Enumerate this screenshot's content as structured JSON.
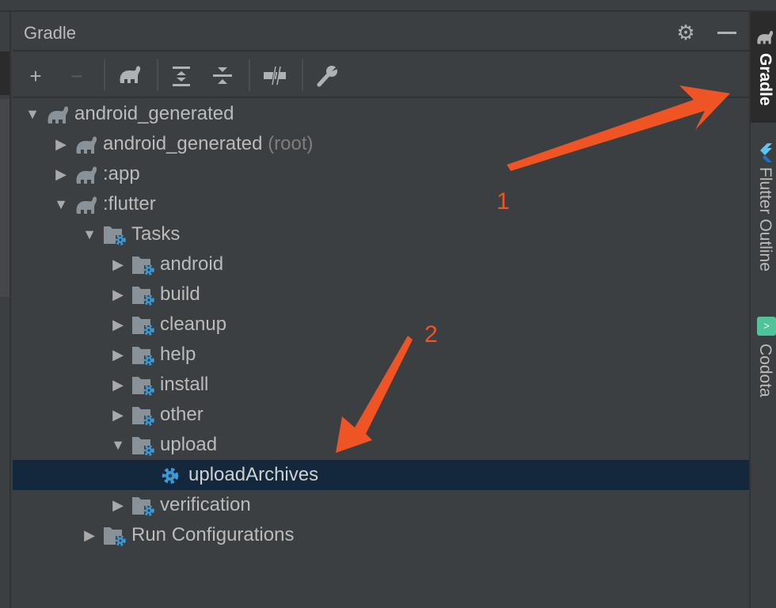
{
  "panel": {
    "title": "Gradle",
    "settings_icon": "gear-icon",
    "hide_icon": "minimize-icon"
  },
  "toolbar": {
    "items": [
      "add",
      "remove",
      "refresh-gradle",
      "expand-all",
      "collapse-all",
      "toggle-offline",
      "build-settings"
    ]
  },
  "tree": [
    {
      "label": "android_generated",
      "suffix": "",
      "level": 0,
      "expanded": true,
      "icon": "gradle-elephant-icon"
    },
    {
      "label": "android_generated",
      "suffix": "(root)",
      "level": 1,
      "expanded": false,
      "icon": "gradle-elephant-icon"
    },
    {
      "label": ":app",
      "suffix": "",
      "level": 1,
      "expanded": false,
      "icon": "gradle-elephant-icon"
    },
    {
      "label": ":flutter",
      "suffix": "",
      "level": 1,
      "expanded": true,
      "icon": "gradle-elephant-icon"
    },
    {
      "label": "Tasks",
      "suffix": "",
      "level": 2,
      "expanded": true,
      "icon": "task-folder-icon"
    },
    {
      "label": "android",
      "suffix": "",
      "level": 3,
      "expanded": false,
      "icon": "task-folder-icon"
    },
    {
      "label": "build",
      "suffix": "",
      "level": 3,
      "expanded": false,
      "icon": "task-folder-icon"
    },
    {
      "label": "cleanup",
      "suffix": "",
      "level": 3,
      "expanded": false,
      "icon": "task-folder-icon"
    },
    {
      "label": "help",
      "suffix": "",
      "level": 3,
      "expanded": false,
      "icon": "task-folder-icon"
    },
    {
      "label": "install",
      "suffix": "",
      "level": 3,
      "expanded": false,
      "icon": "task-folder-icon"
    },
    {
      "label": "other",
      "suffix": "",
      "level": 3,
      "expanded": false,
      "icon": "task-folder-icon"
    },
    {
      "label": "upload",
      "suffix": "",
      "level": 3,
      "expanded": true,
      "icon": "task-folder-icon"
    },
    {
      "label": "uploadArchives",
      "suffix": "",
      "level": 4,
      "leaf": true,
      "selected": true,
      "icon": "gear-task-icon"
    },
    {
      "label": "verification",
      "suffix": "",
      "level": 3,
      "expanded": false,
      "icon": "task-folder-icon"
    },
    {
      "label": "Run Configurations",
      "suffix": "",
      "level": 2,
      "expanded": false,
      "icon": "task-folder-icon"
    }
  ],
  "right_tabs": [
    {
      "label": "Gradle",
      "active": true,
      "icon": "gradle-elephant-icon"
    },
    {
      "label": "Flutter Outline",
      "active": false,
      "icon": "flutter-icon"
    },
    {
      "label": "Codota",
      "active": false,
      "icon": "codota-icon"
    }
  ],
  "annotations": {
    "label1": "1",
    "label2": "2",
    "color": "#ee5424"
  },
  "colors": {
    "selection": "#13283c",
    "gear": "#3d9ad6"
  }
}
